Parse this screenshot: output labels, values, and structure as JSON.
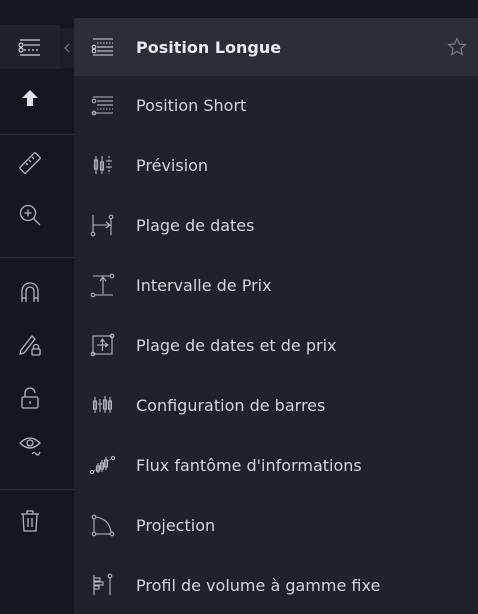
{
  "menu": {
    "items": [
      {
        "label": "Position Longue",
        "icon": "long-position-icon"
      },
      {
        "label": "Position Short",
        "icon": "short-position-icon"
      },
      {
        "label": "Prévision",
        "icon": "forecast-icon"
      },
      {
        "label": "Plage de dates",
        "icon": "date-range-icon"
      },
      {
        "label": "Intervalle de Prix",
        "icon": "price-range-icon"
      },
      {
        "label": "Plage de dates et de prix",
        "icon": "date-price-range-icon"
      },
      {
        "label": "Configuration de barres",
        "icon": "bars-pattern-icon"
      },
      {
        "label": "Flux fantôme d'informations",
        "icon": "ghost-feed-icon"
      },
      {
        "label": "Projection",
        "icon": "projection-icon"
      },
      {
        "label": "Profil de volume à gamme fixe",
        "icon": "fixed-range-volume-profile-icon"
      }
    ],
    "favorite_icon": "star-icon"
  },
  "toolbar": {
    "tools": [
      "prediction-tools-icon",
      "arrow-up-icon",
      "ruler-icon",
      "zoom-in-icon",
      "magnet-icon",
      "lock-drawing-icon",
      "unlock-icon",
      "eye-icon",
      "trash-icon"
    ]
  },
  "colors": {
    "background": "#131722",
    "menu_background": "#1e222d",
    "hover_background": "#2a2e39",
    "text": "#d1d4dc",
    "icon": "#b2b5be"
  }
}
